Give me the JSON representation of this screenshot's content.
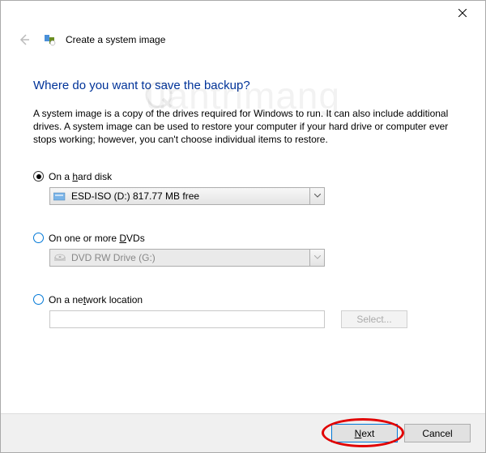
{
  "window": {
    "title": "Create a system image"
  },
  "page": {
    "heading": "Where do you want to save the backup?",
    "description": "A system image is a copy of the drives required for Windows to run. It can also include additional drives. A system image can be used to restore your computer if your hard drive or computer ever stops working; however, you can't choose individual items to restore."
  },
  "options": {
    "hard_disk": {
      "label_pre": "On a ",
      "label_ul": "h",
      "label_post": "ard disk",
      "value": "ESD-ISO (D:)  817.77 MB free"
    },
    "dvds": {
      "label_pre": "On one or more ",
      "label_ul": "D",
      "label_post": "VDs",
      "value": "DVD RW Drive (G:)"
    },
    "network": {
      "label_pre": "On a ne",
      "label_ul": "t",
      "label_post": "work location",
      "select_button": "Select..."
    }
  },
  "footer": {
    "next_ul": "N",
    "next_post": "ext",
    "cancel": "Cancel"
  },
  "watermark": "uantrimang"
}
